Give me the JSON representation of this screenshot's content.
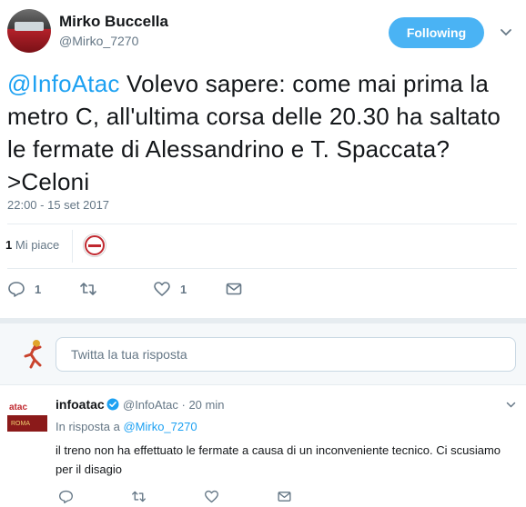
{
  "tweet": {
    "author_name": "Mirko Buccella",
    "author_handle": "@Mirko_7270",
    "follow_label": "Following",
    "mention": "@InfoAtac",
    "text": " Volevo sapere: come mai prima la metro C, all'ultima corsa delle 20.30 ha saltato le fermate di Alessandrino e T. Spaccata?>Celoni",
    "timestamp": "22:00 - 15 set 2017",
    "likes_count": "1",
    "likes_label": "Mi piace",
    "actions": {
      "reply_count": "1",
      "retweet_count": "",
      "like_count": "1"
    }
  },
  "reply_composer": {
    "placeholder": "Twitta la tua risposta"
  },
  "reply": {
    "author_name": "infoatac",
    "meta": "@InfoAtac · 20 min",
    "in_reply_prefix": "In risposta a",
    "in_reply_handle": "@Mirko_7270",
    "text": "il treno non ha effettuato le fermate a causa di un inconveniente tecnico. Ci scusiamo per il disagio",
    "avatar_text_top": "atac",
    "avatar_text_bottom": "ROMA"
  },
  "colors": {
    "accent": "#1da1f2",
    "follow_button": "#4ab3f4",
    "secondary_text": "#657786",
    "divider": "#e6ecf0"
  },
  "icons": [
    "chevron-down-icon",
    "reply-icon",
    "retweet-icon",
    "heart-icon",
    "direct-message-icon",
    "verified-icon"
  ]
}
